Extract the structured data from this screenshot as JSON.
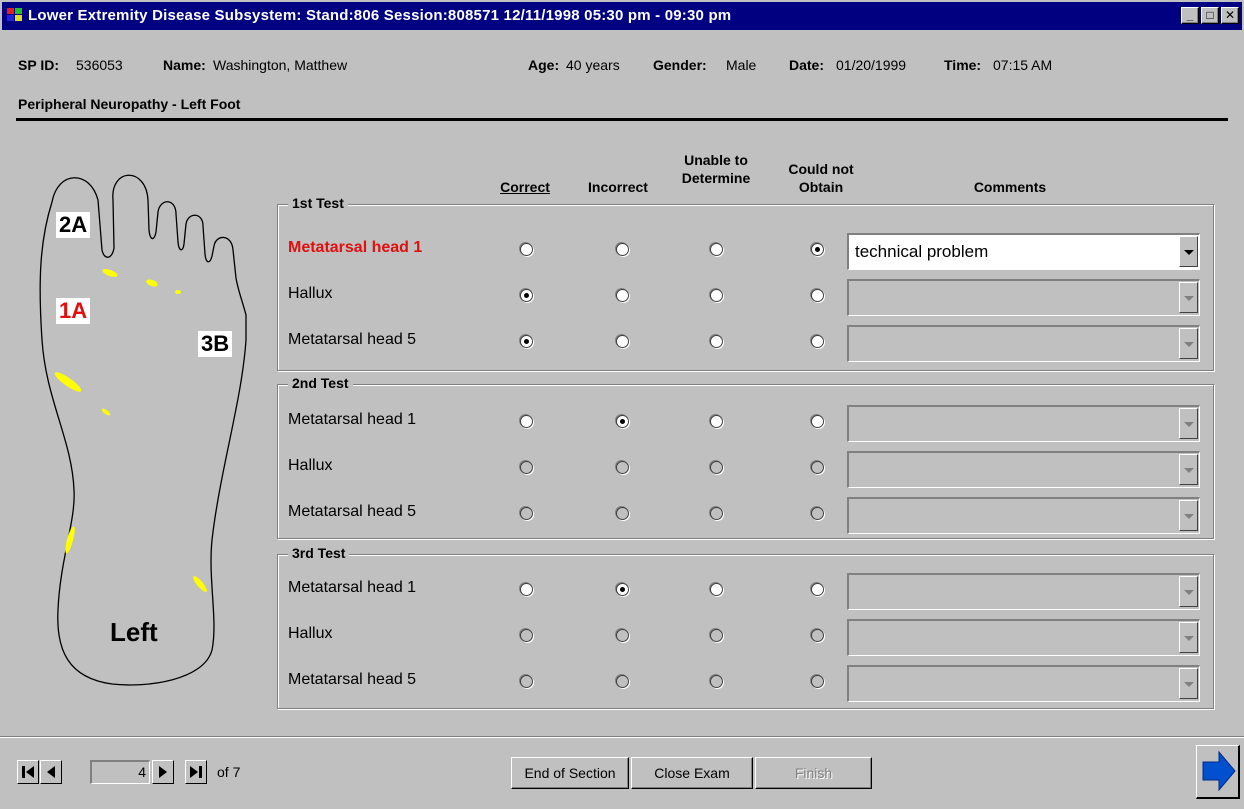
{
  "window": {
    "title": "Lower Extremity Disease Subsystem: Stand:806 Session:808571 12/11/1998 05:30 pm - 09:30 pm",
    "minimize": "_",
    "maximize": "□",
    "close": "✕"
  },
  "info": {
    "sp_id_label": "SP ID:",
    "sp_id": "536053",
    "name_label": "Name:",
    "name": "Washington, Matthew",
    "age_label": "Age:",
    "age": "40 years",
    "gender_label": "Gender:",
    "gender": "Male",
    "date_label": "Date:",
    "date": "01/20/1999",
    "time_label": "Time:",
    "time": "07:15 AM"
  },
  "section_title": "Peripheral Neuropathy - Left Foot",
  "foot": {
    "labels": {
      "l2a": "2A",
      "l1a": "1A",
      "l3b": "3B",
      "left": "Left"
    }
  },
  "columns": {
    "correct": "Correct",
    "incorrect": "Incorrect",
    "unable_line1": "Unable to",
    "unable_line2": "Determine",
    "couldnot_line1": "Could not",
    "couldnot_line2": "Obtain",
    "comments": "Comments"
  },
  "tests": [
    {
      "title": "1st Test",
      "rows": [
        {
          "label": "Metatarsal head 1",
          "selected": "could_not_obtain",
          "comment": "technical problem"
        },
        {
          "label": "Hallux",
          "selected": "correct",
          "comment": ""
        },
        {
          "label": "Metatarsal head 5",
          "selected": "correct",
          "comment": ""
        }
      ]
    },
    {
      "title": "2nd Test",
      "rows": [
        {
          "label": "Metatarsal head 1",
          "selected": "incorrect",
          "comment": ""
        },
        {
          "label": "Hallux",
          "selected": "",
          "comment": ""
        },
        {
          "label": "Metatarsal head 5",
          "selected": "",
          "comment": ""
        }
      ]
    },
    {
      "title": "3rd Test",
      "rows": [
        {
          "label": "Metatarsal head 1",
          "selected": "incorrect",
          "comment": ""
        },
        {
          "label": "Hallux",
          "selected": "",
          "comment": ""
        },
        {
          "label": "Metatarsal head 5",
          "selected": "",
          "comment": ""
        }
      ]
    }
  ],
  "nav": {
    "page": "4",
    "of": "of 7",
    "end_of_section": "End of Section",
    "close_exam": "Close Exam",
    "finish": "Finish"
  },
  "colors": {
    "titlebar": "#000080",
    "highlight": "#e01010",
    "foot_marks": "#ffff00",
    "next_arrow": "#0050d0"
  }
}
